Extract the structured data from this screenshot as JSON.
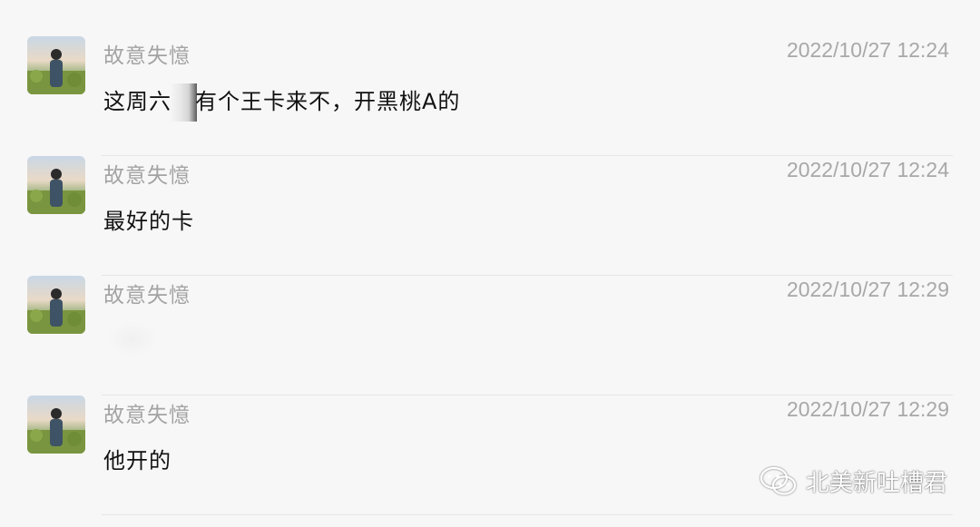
{
  "messages": [
    {
      "sender": "故意失憶",
      "time": "2022/10/27 12:24",
      "text_a": "这周六",
      "text_b": "有个王卡来不，开黑桃A的"
    },
    {
      "sender": "故意失憶",
      "time": "2022/10/27 12:24",
      "text": "最好的卡"
    },
    {
      "sender": "故意失憶",
      "time": "2022/10/27 12:29",
      "text": ""
    },
    {
      "sender": "故意失憶",
      "time": "2022/10/27 12:29",
      "text": "他开的"
    }
  ],
  "watermark": {
    "label": "北美新吐槽君",
    "icon": "wechat-icon"
  },
  "colors": {
    "background": "#f7f7f7",
    "name": "#a3a3a3",
    "time": "#a8a8a8",
    "text": "#111111",
    "divider": "#e6e6e6"
  }
}
